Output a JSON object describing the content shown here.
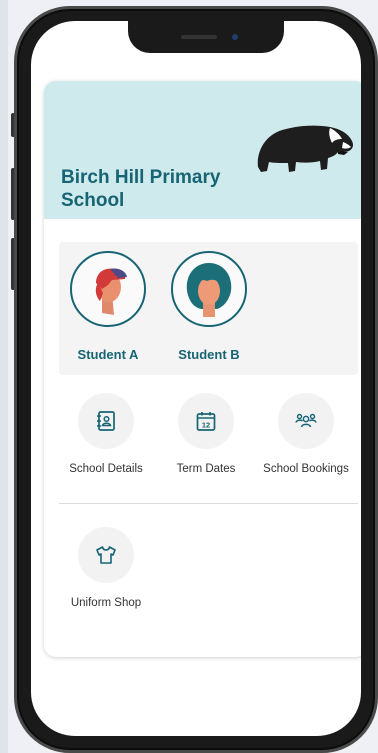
{
  "school": {
    "name": "Birch Hill Primary School"
  },
  "students": [
    {
      "label": "Student A"
    },
    {
      "label": "Student B"
    }
  ],
  "tiles": {
    "school_details": "School Details",
    "term_dates": "Term Dates",
    "term_dates_day": "12",
    "school_bookings": "School Bookings",
    "uniform_shop": "Uniform Shop"
  },
  "colors": {
    "brand": "#176474",
    "header_bg": "#cfeaec"
  }
}
